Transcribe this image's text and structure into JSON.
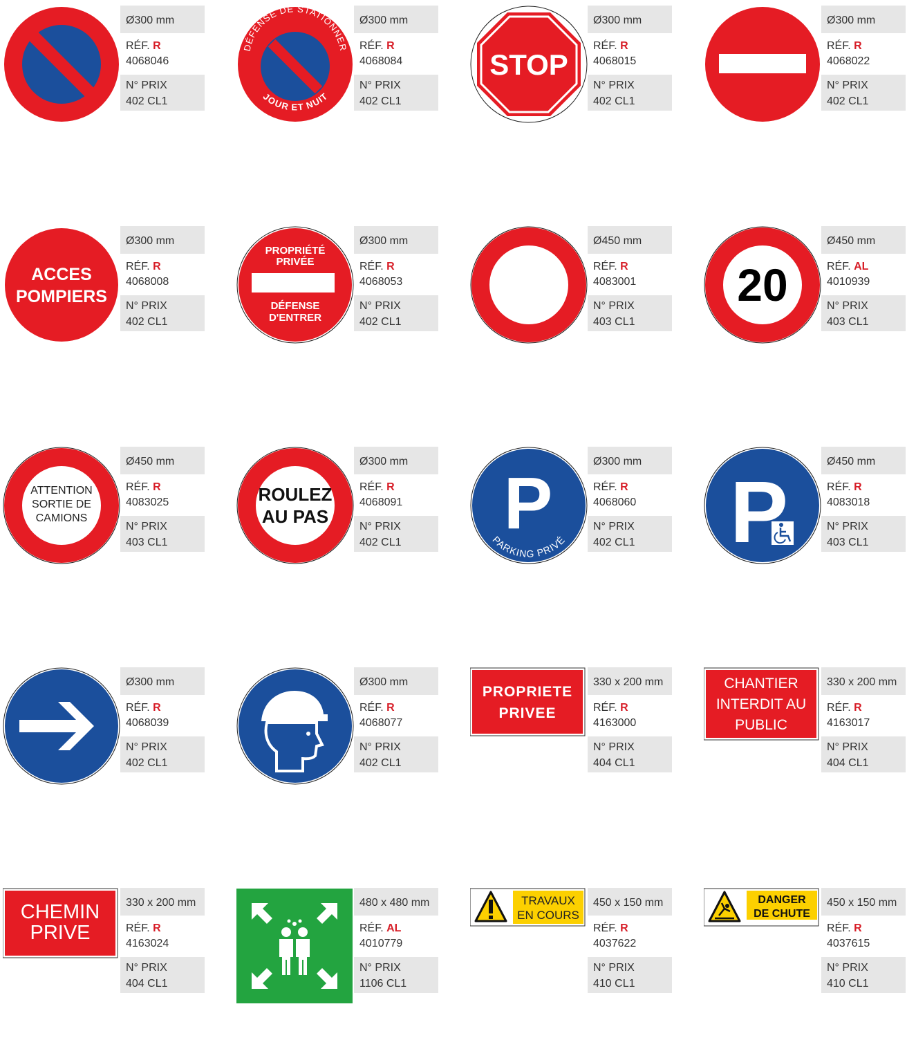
{
  "colors": {
    "red": "#e51c24",
    "blue": "#1b4f9c",
    "green": "#23a440",
    "yellow": "#fcd000",
    "panel": "#e6e6e6",
    "ref_code": "#d71e28"
  },
  "items": [
    {
      "size": "Ø300 mm",
      "ref_label": "RÉF.",
      "ref_code": "R",
      "ref_number": "4068046",
      "prix_label": "N° PRIX",
      "prix_value": "402 CL1",
      "sign": {
        "type": "no-parking"
      }
    },
    {
      "size": "Ø300 mm",
      "ref_label": "RÉF.",
      "ref_code": "R",
      "ref_number": "4068084",
      "prix_label": "N° PRIX",
      "prix_value": "402 CL1",
      "sign": {
        "type": "no-parking-text",
        "top_text": "DÉFENSE DE STATIONNER",
        "bottom_text": "JOUR ET NUIT"
      }
    },
    {
      "size": "Ø300 mm",
      "ref_label": "RÉF.",
      "ref_code": "R",
      "ref_number": "4068015",
      "prix_label": "N° PRIX",
      "prix_value": "402 CL1",
      "sign": {
        "type": "stop",
        "text": "STOP"
      }
    },
    {
      "size": "Ø300 mm",
      "ref_label": "RÉF.",
      "ref_code": "R",
      "ref_number": "4068022",
      "prix_label": "N° PRIX",
      "prix_value": "402 CL1",
      "sign": {
        "type": "no-entry"
      }
    },
    {
      "size": "Ø300 mm",
      "ref_label": "RÉF.",
      "ref_code": "R",
      "ref_number": "4068008",
      "prix_label": "N° PRIX",
      "prix_value": "402 CL1",
      "sign": {
        "type": "acces-pompiers",
        "line1": "ACCES",
        "line2": "POMPIERS"
      }
    },
    {
      "size": "Ø300 mm",
      "ref_label": "RÉF.",
      "ref_code": "R",
      "ref_number": "4068053",
      "prix_label": "N° PRIX",
      "prix_value": "402 CL1",
      "sign": {
        "type": "propriete-privee",
        "line1": "PROPRIÉTÉ",
        "line2": "PRIVÉE",
        "line3": "DÉFENSE",
        "line4": "D'ENTRER"
      }
    },
    {
      "size": "Ø450 mm",
      "ref_label": "RÉF.",
      "ref_code": "R",
      "ref_number": "4083001",
      "prix_label": "N° PRIX",
      "prix_value": "403 CL1",
      "sign": {
        "type": "ring"
      }
    },
    {
      "size": "Ø450 mm",
      "ref_label": "RÉF.",
      "ref_code": "AL",
      "ref_number": "4010939",
      "prix_label": "N° PRIX",
      "prix_value": "403 CL1",
      "sign": {
        "type": "speed",
        "text": "20"
      }
    },
    {
      "size": "Ø450 mm",
      "ref_label": "RÉF.",
      "ref_code": "R",
      "ref_number": "4083025",
      "prix_label": "N° PRIX",
      "prix_value": "403 CL1",
      "sign": {
        "type": "ring-text",
        "line1": "ATTENTION",
        "line2": "SORTIE DE",
        "line3": "CAMIONS"
      }
    },
    {
      "size": "Ø300 mm",
      "ref_label": "RÉF.",
      "ref_code": "R",
      "ref_number": "4068091",
      "prix_label": "N° PRIX",
      "prix_value": "402 CL1",
      "sign": {
        "type": "ring-bold",
        "line1": "ROULEZ",
        "line2": "AU PAS"
      }
    },
    {
      "size": "Ø300 mm",
      "ref_label": "RÉF.",
      "ref_code": "R",
      "ref_number": "4068060",
      "prix_label": "N° PRIX",
      "prix_value": "402 CL1",
      "sign": {
        "type": "parking-prive",
        "letter": "P",
        "text": "PARKING PRIVÉ"
      }
    },
    {
      "size": "Ø450 mm",
      "ref_label": "RÉF.",
      "ref_code": "R",
      "ref_number": "4083018",
      "prix_label": "N° PRIX",
      "prix_value": "403 CL1",
      "sign": {
        "type": "parking-handicap",
        "letter": "P"
      }
    },
    {
      "size": "Ø300 mm",
      "ref_label": "RÉF.",
      "ref_code": "R",
      "ref_number": "4068039",
      "prix_label": "N° PRIX",
      "prix_value": "402 CL1",
      "sign": {
        "type": "arrow-right"
      }
    },
    {
      "size": "Ø300 mm",
      "ref_label": "RÉF.",
      "ref_code": "R",
      "ref_number": "4068077",
      "prix_label": "N° PRIX",
      "prix_value": "402 CL1",
      "sign": {
        "type": "helmet"
      }
    },
    {
      "size": "330 x 200 mm",
      "ref_label": "RÉF.",
      "ref_code": "R",
      "ref_number": "4163000",
      "prix_label": "N° PRIX",
      "prix_value": "404 CL1",
      "sign": {
        "type": "rect-bold",
        "line1": "PROPRIETE",
        "line2": "PRIVEE"
      }
    },
    {
      "size": "330 x 200 mm",
      "ref_label": "RÉF.",
      "ref_code": "R",
      "ref_number": "4163017",
      "prix_label": "N° PRIX",
      "prix_value": "404 CL1",
      "sign": {
        "type": "rect-light",
        "line1": "CHANTIER",
        "line2": "INTERDIT AU",
        "line3": "PUBLIC"
      }
    },
    {
      "size": "330 x 200 mm",
      "ref_label": "RÉF.",
      "ref_code": "R",
      "ref_number": "4163024",
      "prix_label": "N° PRIX",
      "prix_value": "404 CL1",
      "sign": {
        "type": "rect-light-big",
        "line1": "CHEMIN",
        "line2": "PRIVE"
      }
    },
    {
      "size": "480 x 480 mm",
      "ref_label": "RÉF.",
      "ref_code": "AL",
      "ref_number": "4010779",
      "prix_label": "N° PRIX",
      "prix_value": "1106 CL1",
      "sign": {
        "type": "assembly-point"
      }
    },
    {
      "size": "450 x 150 mm",
      "ref_label": "RÉF.",
      "ref_code": "R",
      "ref_number": "4037622",
      "prix_label": "N° PRIX",
      "prix_value": "410 CL1",
      "sign": {
        "type": "warning-travaux",
        "line1": "TRAVAUX",
        "line2": "EN COURS"
      }
    },
    {
      "size": "450 x 150 mm",
      "ref_label": "RÉF.",
      "ref_code": "R",
      "ref_number": "4037615",
      "prix_label": "N° PRIX",
      "prix_value": "410 CL1",
      "sign": {
        "type": "warning-chute",
        "line1": "DANGER",
        "line2": "DE CHUTE"
      }
    }
  ]
}
